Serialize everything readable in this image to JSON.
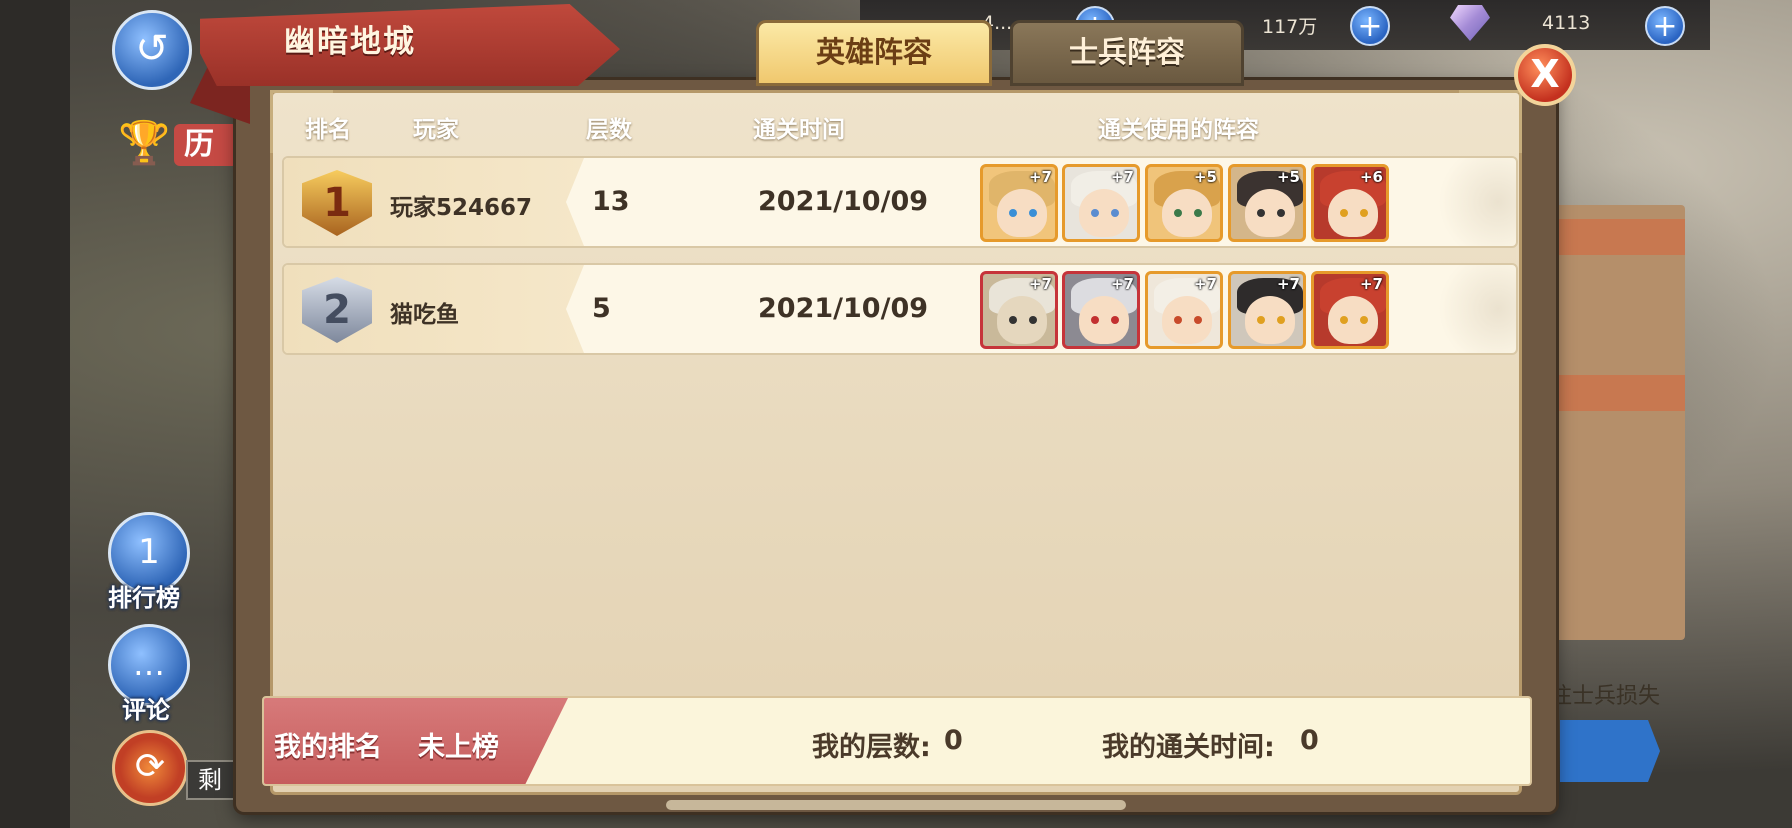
{
  "resources": {
    "gold": "4...",
    "food": "117万",
    "gems": "4113"
  },
  "left_menu": {
    "history_label": "历",
    "leaderboard_label": "排行榜",
    "comments_label": "评论",
    "remaining_prefix": "剩"
  },
  "right_hint": "注士兵损失",
  "dialog": {
    "title": "幽暗地城",
    "tabs": [
      "英雄阵容",
      "士兵阵容"
    ],
    "active_tab": "英雄阵容",
    "close_label": "X",
    "columns": {
      "rank": "排名",
      "player": "玩家",
      "floors": "层数",
      "clear_time": "通关时间",
      "lineup": "通关使用的阵容"
    },
    "rows": [
      {
        "rank": "1",
        "player": "玩家524667",
        "floors": "13",
        "clear_time": "2021/10/09",
        "heroes": [
          {
            "level": "+7",
            "frame": "gold"
          },
          {
            "level": "+7",
            "frame": "gold"
          },
          {
            "level": "+5",
            "frame": "gold"
          },
          {
            "level": "+5",
            "frame": "gold"
          },
          {
            "level": "+6",
            "frame": "gold"
          }
        ]
      },
      {
        "rank": "2",
        "player": "猫吃鱼",
        "floors": "5",
        "clear_time": "2021/10/09",
        "heroes": [
          {
            "level": "+7",
            "frame": "red"
          },
          {
            "level": "+7",
            "frame": "red"
          },
          {
            "level": "+7",
            "frame": "gold"
          },
          {
            "level": "+7",
            "frame": "gold"
          },
          {
            "level": "+7",
            "frame": "gold"
          }
        ]
      }
    ],
    "my_rank": {
      "label": "我的排名",
      "value": "未上榜",
      "floors_label": "我的层数:",
      "floors_value": "0",
      "time_label": "我的通关时间:",
      "time_value": "0"
    }
  }
}
